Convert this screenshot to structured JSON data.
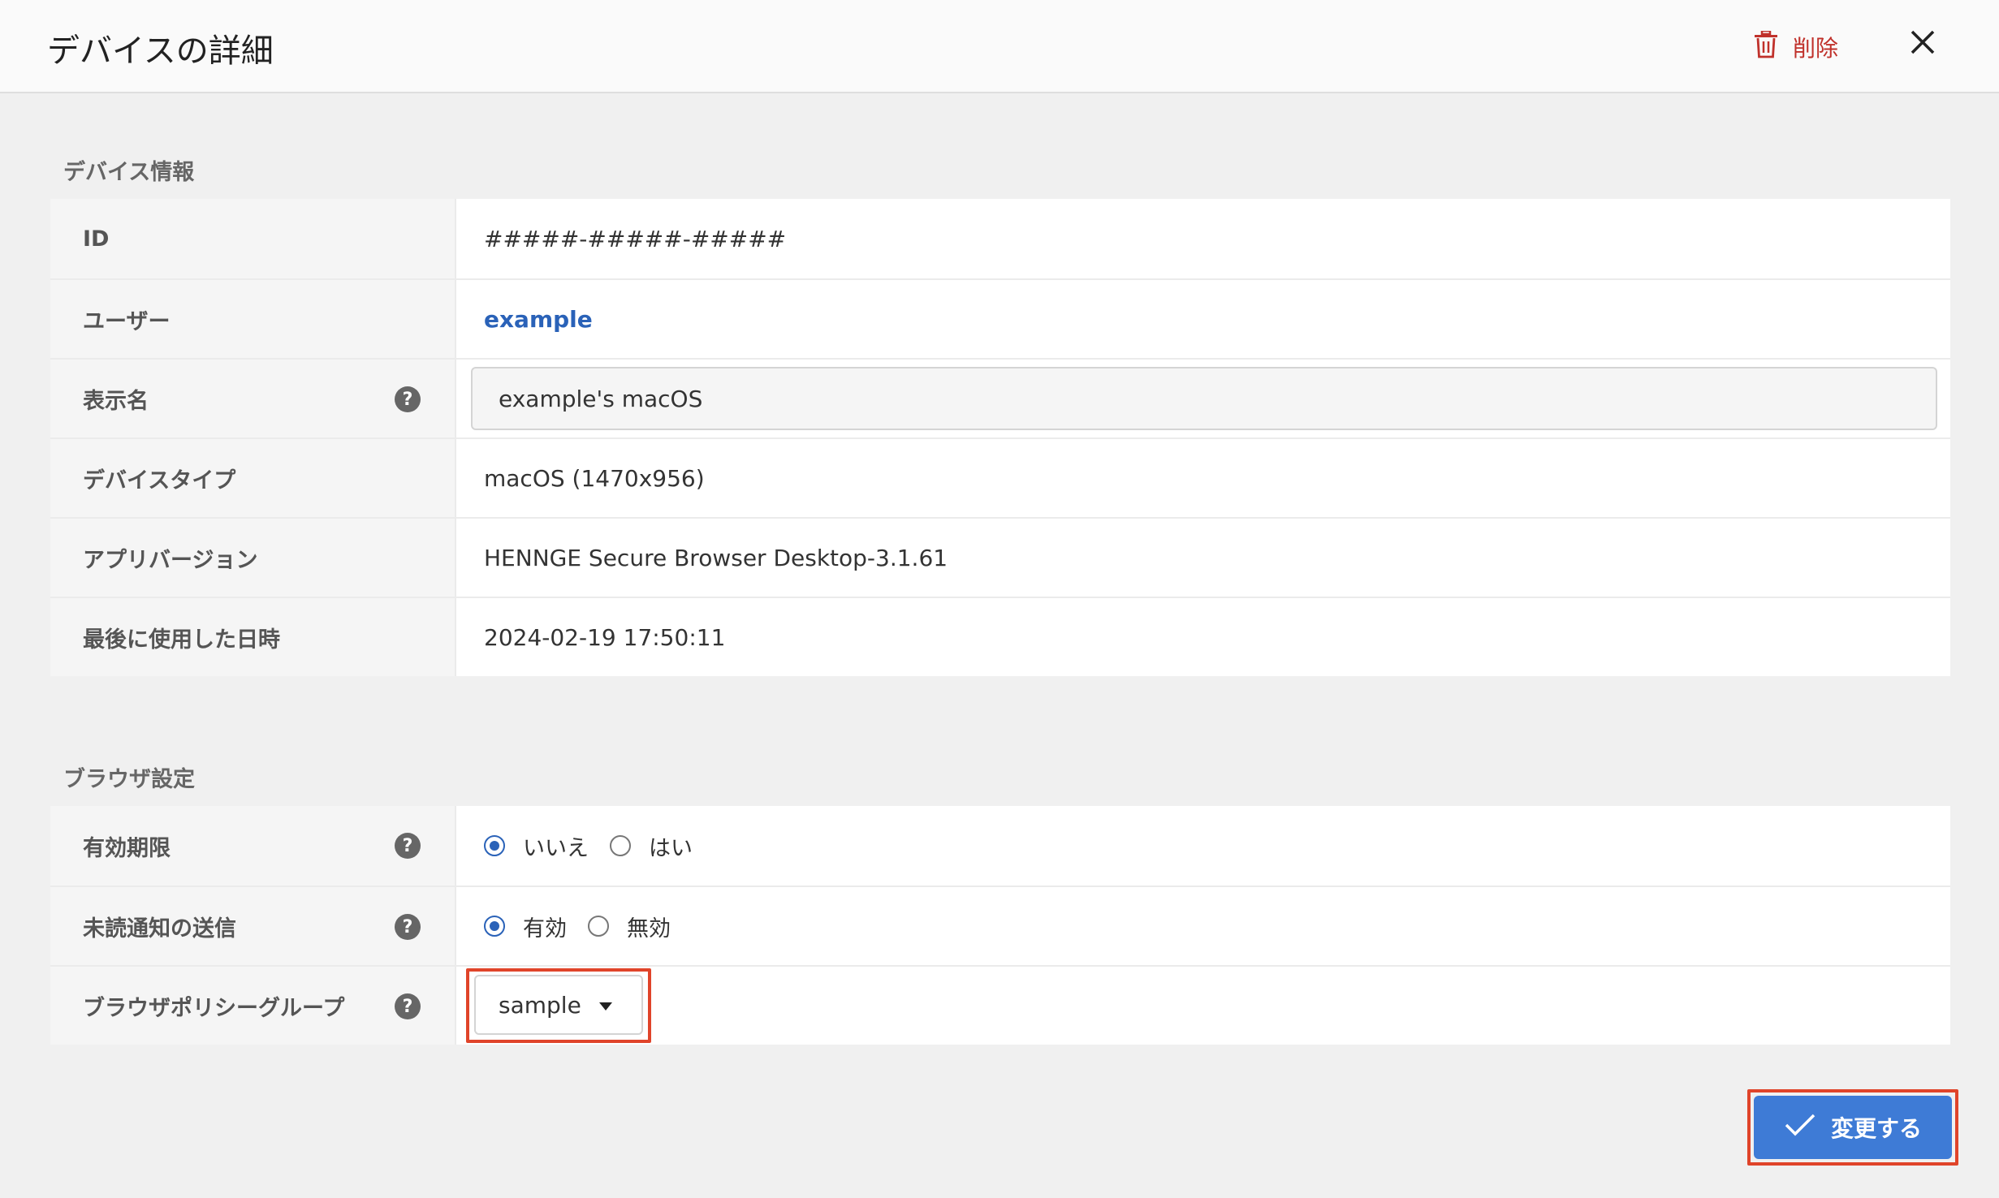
{
  "header": {
    "title": "デバイスの詳細",
    "delete_label": "削除",
    "delete_icon": "trash-icon",
    "close_icon": "close-icon"
  },
  "device_info": {
    "section_title": "デバイス情報",
    "rows": [
      {
        "label": "ID",
        "value": "#####-#####-#####"
      },
      {
        "label": "ユーザー",
        "value": "example"
      },
      {
        "label": "表示名",
        "value": "example's macOS"
      },
      {
        "label": "デバイスタイプ",
        "value": "macOS (1470x956)"
      },
      {
        "label": "アプリバージョン",
        "value": "HENNGE Secure Browser Desktop-3.1.61"
      },
      {
        "label": "最後に使用した日時",
        "value": "2024-02-19 17:50:11"
      }
    ]
  },
  "browser_settings": {
    "section_title": "ブラウザ設定",
    "expiry": {
      "label": "有効期限",
      "options": [
        "いいえ",
        "はい"
      ],
      "selected": "いいえ"
    },
    "unread_notification": {
      "label": "未読通知の送信",
      "options": [
        "有効",
        "無効"
      ],
      "selected": "有効"
    },
    "policy_group": {
      "label": "ブラウザポリシーグループ",
      "selected": "sample"
    }
  },
  "footer": {
    "submit_label": "変更する",
    "submit_icon": "check-icon"
  },
  "colors": {
    "accent": "#3e7bd6",
    "link": "#2a62b8",
    "danger": "#c0312b",
    "highlight": "#e0442a"
  }
}
